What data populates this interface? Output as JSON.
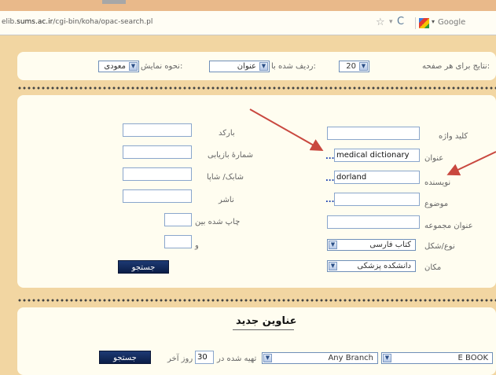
{
  "browser": {
    "url_prefix": "elib.",
    "url_domain": "sums.ac.ir",
    "url_path": "/cgi-bin/koha/opac-search.pl",
    "star_icon": "☆",
    "dropdown_icon": "▾",
    "reload_icon": "C",
    "search_engine_label": "Google",
    "search_caret": "▾"
  },
  "options_bar": {
    "results_per_page_label": "نتایج برای هر صفحه:",
    "results_per_page_value": "20",
    "sort_by_label": "ردیف شده با:",
    "sort_by_value": "عنوان",
    "display_mode_label": "نحوه نمایش:",
    "display_mode_value": "معودی"
  },
  "left_fields": [
    {
      "label": "بارکد",
      "value": ""
    },
    {
      "label": "شمارهٔ بازیابی",
      "value": ""
    },
    {
      "label": "شابک/ شاپا",
      "value": ""
    },
    {
      "label": "ناشر",
      "value": ""
    }
  ],
  "published_between_label": "چاپ شده بین",
  "and_label": "و",
  "right_fields": [
    {
      "label": "کلید واژه",
      "value": ""
    },
    {
      "label": "عنوان",
      "value": "medical dictionary"
    },
    {
      "label": "نویسنده",
      "value": "dorland"
    },
    {
      "label": "موضوع",
      "value": ""
    },
    {
      "label": "عنوان مجموعه",
      "value": ""
    }
  ],
  "lookup_link": "...",
  "type_label": "نوع/شکل",
  "type_value": "کتاب فارسی",
  "location_label": "مکان",
  "location_value": "دانشکده پزشکی",
  "search_button": "جستجو",
  "new_titles": {
    "heading": "عناوین جدید",
    "acquired_label": "تهیه شده در",
    "days_value": "30",
    "days_label": "روز آخر",
    "branch_value": "Any Branch",
    "type_value": "E BOOK",
    "search_button": "جستجو"
  },
  "dropdown_arrow": "▼",
  "colors": {
    "arrow": "#c9483f",
    "button": "#12295c",
    "link": "#1a3fb0"
  }
}
